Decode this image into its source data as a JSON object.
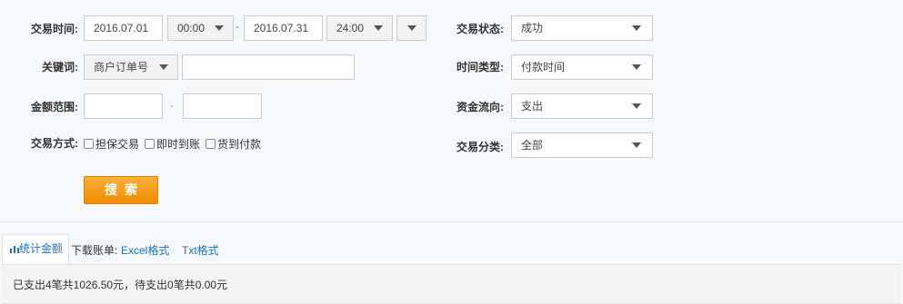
{
  "filters": {
    "time_label": "交易时间:",
    "start_date": "2016.07.01",
    "start_time": "00:00",
    "range_sep": "-",
    "end_date": "2016.07.31",
    "end_time": "24:00",
    "keyword_label": "关键词:",
    "keyword_type": "商户订单号",
    "keyword_value": "",
    "amount_label": "金额范围:",
    "amount_min": "",
    "amount_sep": "-",
    "amount_max": "",
    "method_label": "交易方式:",
    "methods": [
      "担保交易",
      "即时到账",
      "货到付款"
    ],
    "status_label": "交易状态:",
    "status_value": "成功",
    "time_type_label": "时间类型:",
    "time_type_value": "付款时间",
    "flow_label": "资金流向:",
    "flow_value": "支出",
    "category_label": "交易分类:",
    "category_value": "全部",
    "search_button": "搜索"
  },
  "tabs": {
    "stats_label": "统计金额",
    "download_label": "下载账单:",
    "excel_link": "Excel格式",
    "txt_link": "Txt格式"
  },
  "summary": {
    "text": "已支出4笔共1026.50元，待支出0笔共0.00元"
  },
  "colors": {
    "accent": "#1a73c9",
    "button": "#f39800",
    "background": "#f6f9fc"
  }
}
